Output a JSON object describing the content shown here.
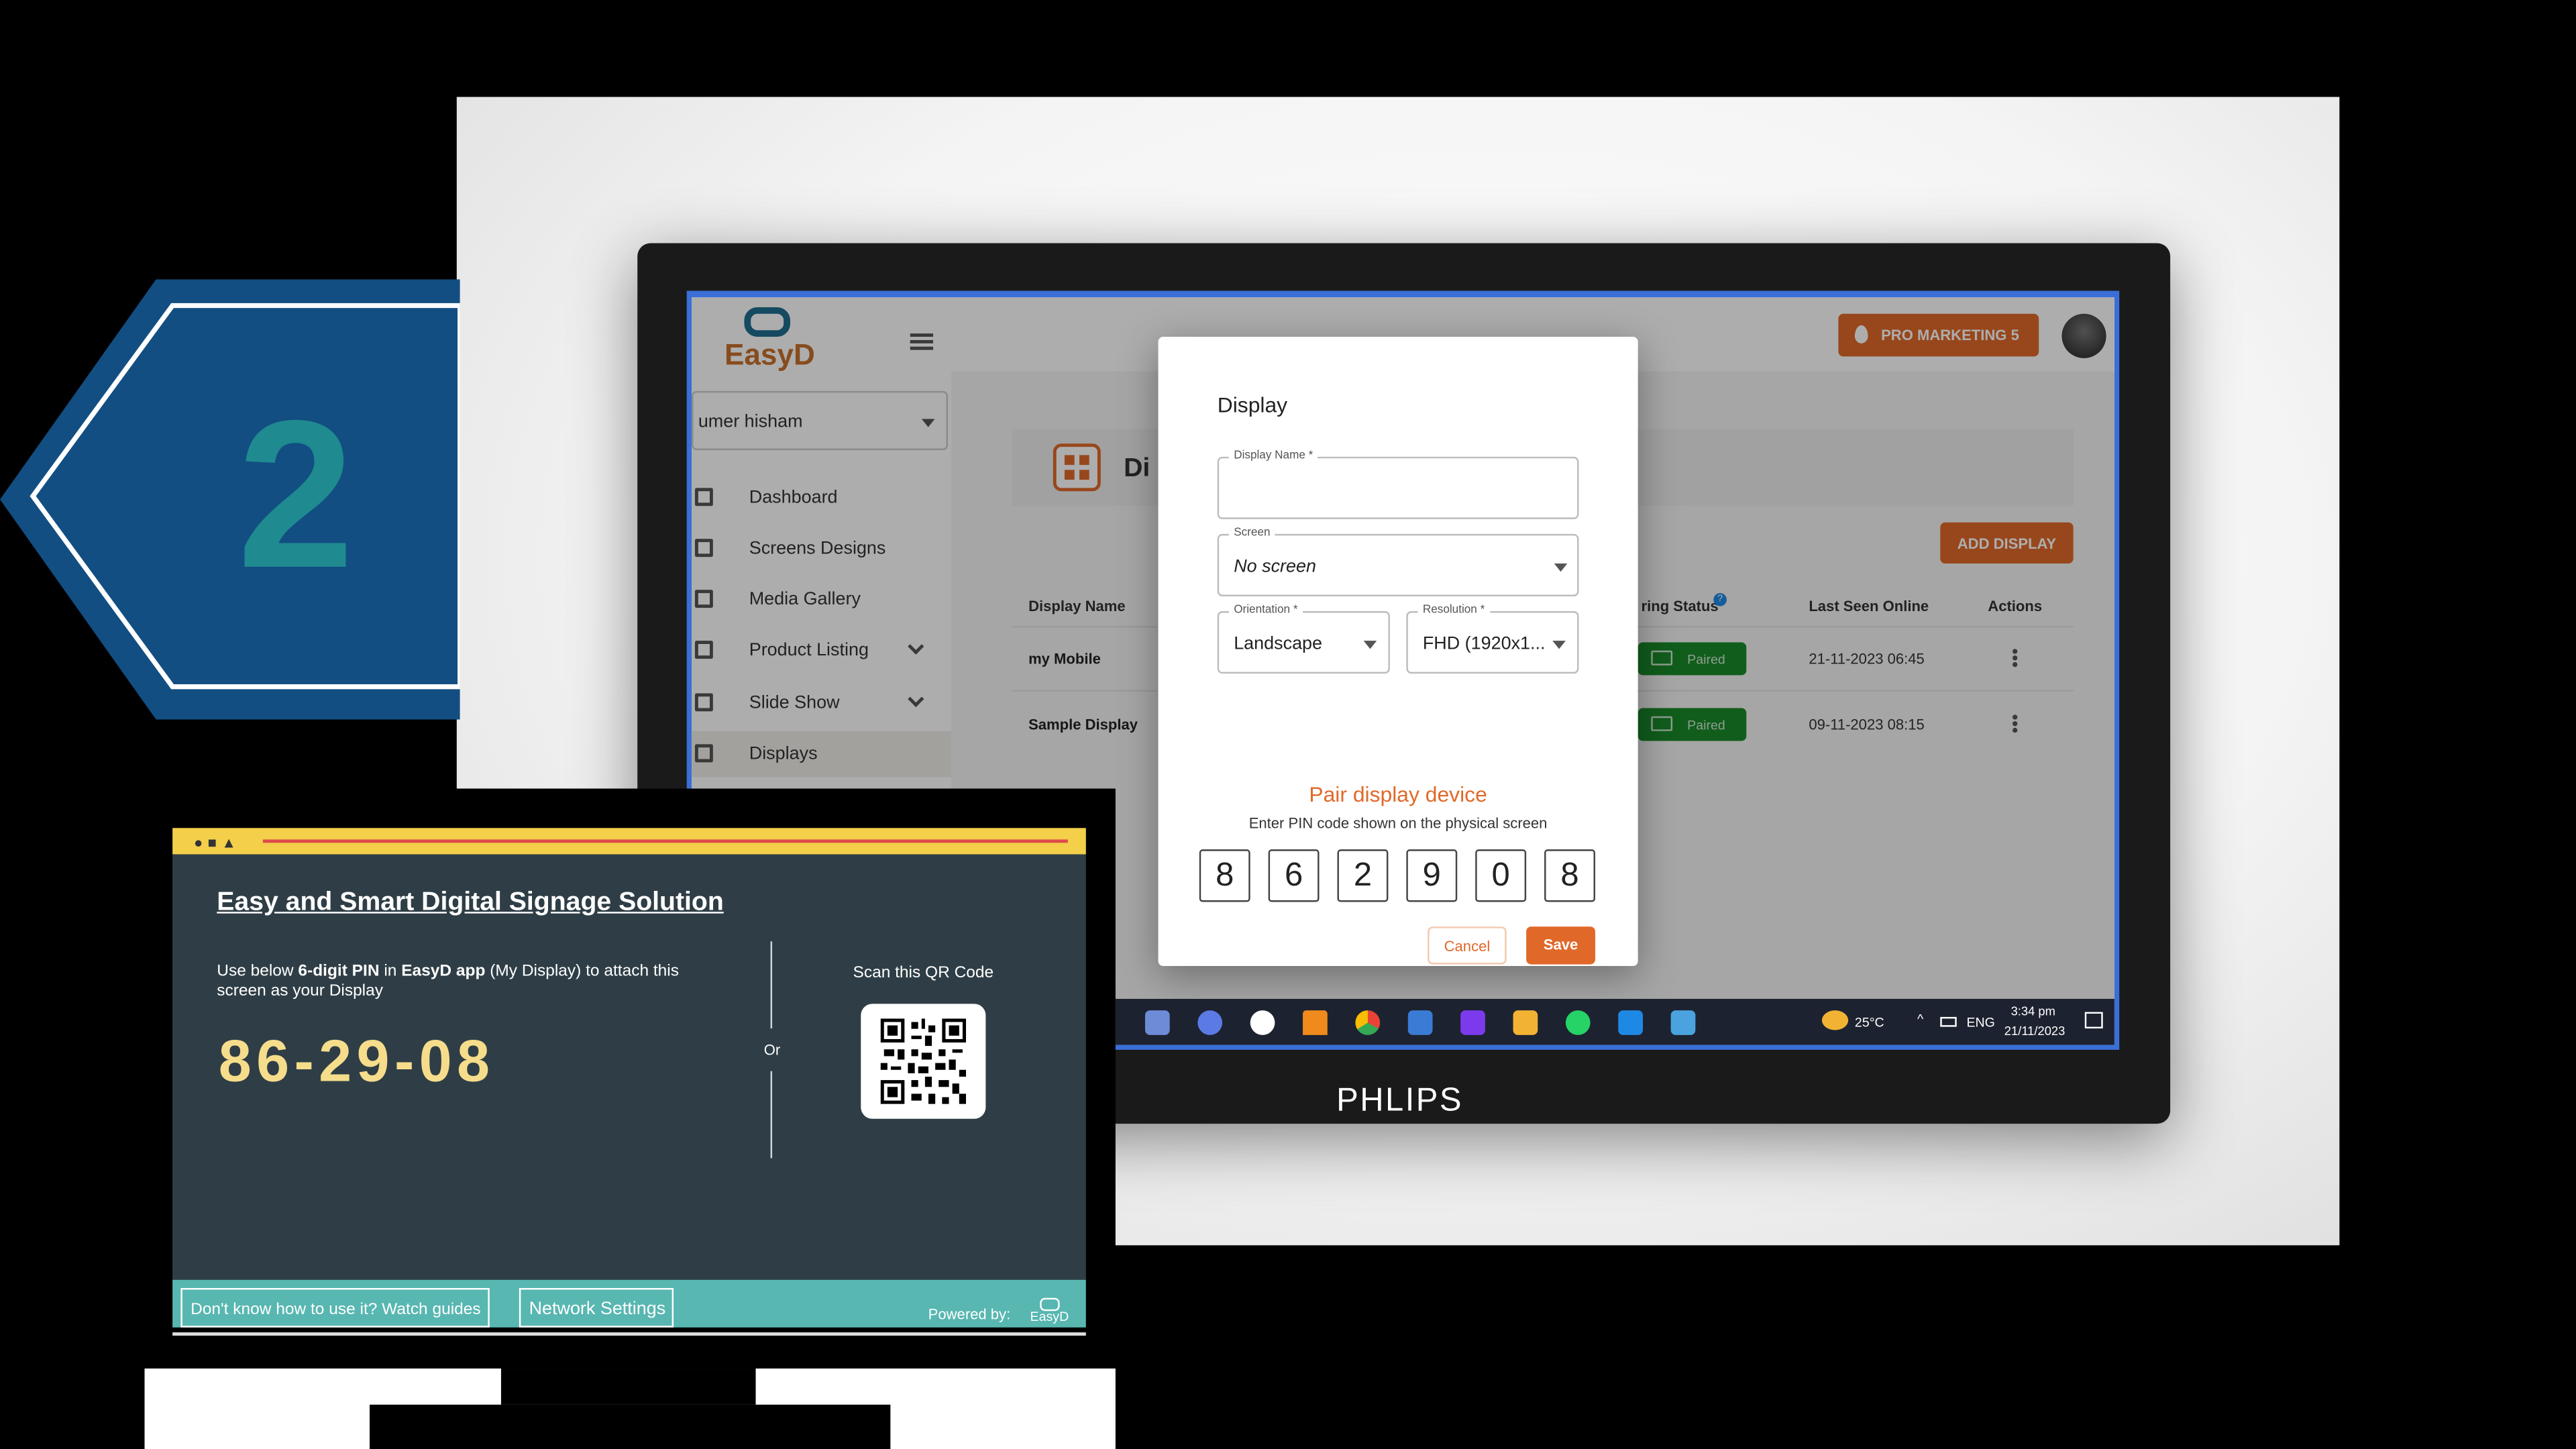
{
  "step_badge": {
    "number": "2"
  },
  "monitor": {
    "brand": "PHLIPS"
  },
  "app": {
    "logo_text": "EasyD",
    "user_select": "umer hisham",
    "nav": [
      {
        "label": "Dashboard",
        "icon": "dashboard-icon"
      },
      {
        "label": "Screens Designs",
        "icon": "screen-design-icon"
      },
      {
        "label": "Media Gallery",
        "icon": "media-gallery-icon"
      },
      {
        "label": "Product Listing",
        "icon": "cart-icon"
      },
      {
        "label": "Slide Show",
        "icon": "slideshow-icon"
      },
      {
        "label": "Displays",
        "icon": "display-icon"
      }
    ],
    "pro_button": "PRO MARKETING 5",
    "page_title": "Di",
    "add_button": "ADD DISPLAY",
    "columns": {
      "display_name": "Display Name",
      "pairing_status": "ring Status",
      "last_seen": "Last Seen Online",
      "actions": "Actions"
    },
    "rows": [
      {
        "name": "my Mobile",
        "status": "Paired",
        "last_seen": "21-11-2023 06:45"
      },
      {
        "name": "Sample Display",
        "status": "Paired",
        "last_seen": "09-11-2023 08:15"
      }
    ]
  },
  "dialog": {
    "title": "Display",
    "display_name_label": "Display Name *",
    "display_name_value": "",
    "screen_label": "Screen",
    "screen_value": "No screen",
    "orientation_label": "Orientation *",
    "orientation_value": "Landscape",
    "resolution_label": "Resolution *",
    "resolution_value": "FHD (1920x1...",
    "pair_title": "Pair display device",
    "pair_subtitle": "Enter PIN code shown on the physical screen",
    "pin": [
      "8",
      "6",
      "2",
      "9",
      "0",
      "8"
    ],
    "cancel": "Cancel",
    "save": "Save"
  },
  "taskbar": {
    "weather": "25°C",
    "language": "ENG",
    "time": "3:34 pm",
    "date": "21/11/2023"
  },
  "pin_card": {
    "title": "Easy and Smart Digital Signage Solution",
    "desc_parts": [
      "Use below ",
      "6-digit PIN",
      " in ",
      "EasyD app",
      " (My Display) to attach this screen as your Display"
    ],
    "pin": "86-29-08",
    "or": "Or",
    "scan_label": "Scan this QR Code",
    "guide_button": "Don't know how to use it? Watch guides",
    "network_button": "Network Settings",
    "powered_by": "Powered by:",
    "powered_logo": "EasyD"
  },
  "colors": {
    "accent": "#e0692a",
    "badge_blue": "#124e82",
    "badge_teal": "#1f8a90",
    "card_bg": "#2f3e46",
    "footer_teal": "#58b7b1",
    "paired_green": "#1a8a2a"
  }
}
